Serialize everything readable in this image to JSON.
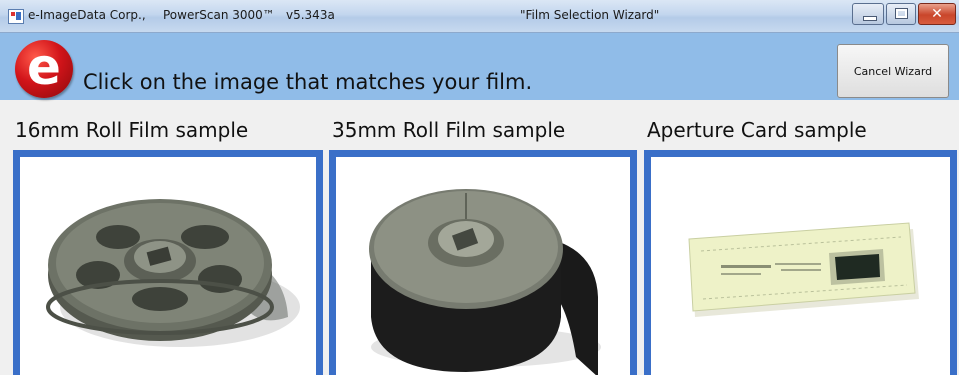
{
  "window": {
    "company": "e-ImageData Corp.,",
    "product": "PowerScan 3000™",
    "version": "v5.343a",
    "title": "\"Film Selection Wizard\""
  },
  "banner": {
    "logo_letter": "e",
    "instruction": "Click on the image that matches your film.",
    "cancel_label": "Cancel Wizard",
    "background": "#90bce8"
  },
  "samples": [
    {
      "label": "16mm Roll Film sample"
    },
    {
      "label": "35mm Roll Film sample"
    },
    {
      "label": "Aperture Card sample"
    }
  ],
  "accent": "#3a6fc8"
}
